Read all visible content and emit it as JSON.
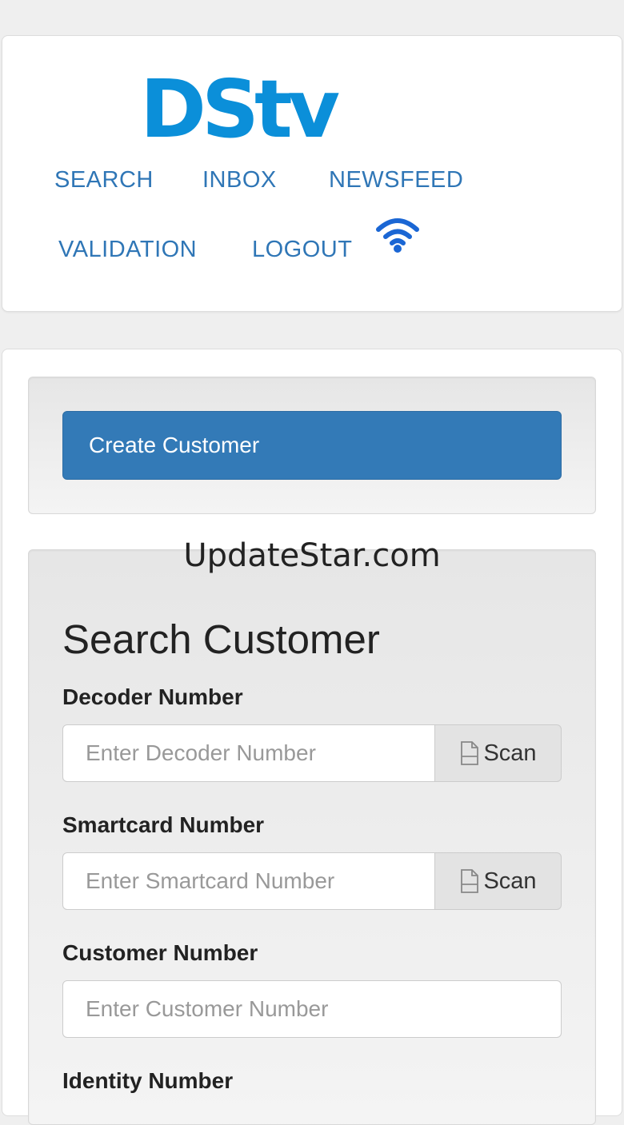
{
  "logo": {
    "text": "DStv"
  },
  "nav": {
    "search": "SEARCH",
    "inbox": "INBOX",
    "newsfeed": "NEWSFEED",
    "validation": "VALIDATION",
    "logout": "LOGOUT",
    "status_icon": "wifi-icon"
  },
  "create": {
    "label": "Create Customer"
  },
  "watermark": "UpdateStar.com",
  "search_form": {
    "title": "Search Customer",
    "decoder": {
      "label": "Decoder Number",
      "placeholder": "Enter Decoder Number",
      "scan_label": "Scan"
    },
    "smartcard": {
      "label": "Smartcard Number",
      "placeholder": "Enter Smartcard Number",
      "scan_label": "Scan"
    },
    "customer": {
      "label": "Customer Number",
      "placeholder": "Enter Customer Number"
    },
    "identity": {
      "label": "Identity Number"
    }
  },
  "colors": {
    "brand_blue": "#0b8fd9",
    "nav_link": "#2f76b6",
    "primary_button": "#337ab7",
    "wifi": "#1a66d4"
  }
}
